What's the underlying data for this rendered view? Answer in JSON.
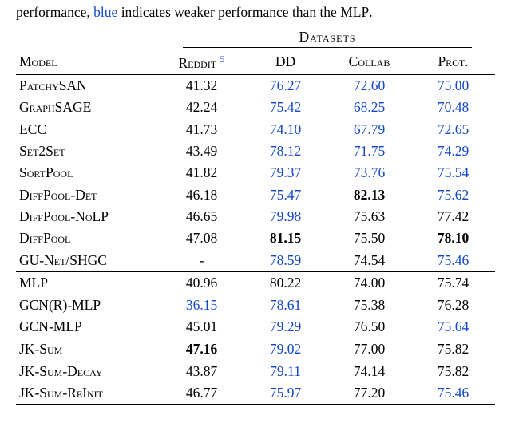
{
  "caption_prefix": "performance, ",
  "caption_blue": "blue",
  "caption_mid": " indicates weaker performance than the ",
  "caption_mlp": "MLP",
  "caption_end": ".",
  "datasets_header": "Datasets",
  "model_header": "Model",
  "columns": [
    {
      "label": "Reddit",
      "sup": "5"
    },
    {
      "label": "DD"
    },
    {
      "label": "Collab"
    },
    {
      "label": "Prot."
    }
  ],
  "groups": [
    {
      "rows": [
        {
          "model": "PatchySAN",
          "vals": [
            {
              "text": "41.32",
              "blue": false,
              "bold": false
            },
            {
              "text": "76.27",
              "blue": true,
              "bold": false
            },
            {
              "text": "72.60",
              "blue": true,
              "bold": false
            },
            {
              "text": "75.00",
              "blue": true,
              "bold": false
            }
          ]
        },
        {
          "model": "GraphSAGE",
          "smallcaps": true,
          "vals": [
            {
              "text": "42.24",
              "blue": false,
              "bold": false
            },
            {
              "text": "75.42",
              "blue": true,
              "bold": false
            },
            {
              "text": "68.25",
              "blue": true,
              "bold": false
            },
            {
              "text": "70.48",
              "blue": true,
              "bold": false
            }
          ]
        },
        {
          "model": "ECC",
          "smallcaps": false,
          "vals": [
            {
              "text": "41.73",
              "blue": false,
              "bold": false
            },
            {
              "text": "74.10",
              "blue": true,
              "bold": false
            },
            {
              "text": "67.79",
              "blue": true,
              "bold": false
            },
            {
              "text": "72.65",
              "blue": true,
              "bold": false
            }
          ]
        },
        {
          "model": "Set2Set",
          "smallcaps": true,
          "vals": [
            {
              "text": "43.49",
              "blue": false,
              "bold": false
            },
            {
              "text": "78.12",
              "blue": true,
              "bold": false
            },
            {
              "text": "71.75",
              "blue": true,
              "bold": false
            },
            {
              "text": "74.29",
              "blue": true,
              "bold": false
            }
          ]
        },
        {
          "model": "SortPool",
          "smallcaps": true,
          "vals": [
            {
              "text": "41.82",
              "blue": false,
              "bold": false
            },
            {
              "text": "79.37",
              "blue": true,
              "bold": false
            },
            {
              "text": "73.76",
              "blue": true,
              "bold": false
            },
            {
              "text": "75.54",
              "blue": true,
              "bold": false
            }
          ]
        },
        {
          "model": "DiffPool-Det",
          "smallcaps": true,
          "vals": [
            {
              "text": "46.18",
              "blue": false,
              "bold": false
            },
            {
              "text": "75.47",
              "blue": true,
              "bold": false
            },
            {
              "text": "82.13",
              "blue": false,
              "bold": true
            },
            {
              "text": "75.62",
              "blue": true,
              "bold": false
            }
          ]
        },
        {
          "model": "DiffPool-NoLP",
          "smallcaps": true,
          "vals": [
            {
              "text": "46.65",
              "blue": false,
              "bold": false
            },
            {
              "text": "79.98",
              "blue": true,
              "bold": false
            },
            {
              "text": "75.63",
              "blue": false,
              "bold": false
            },
            {
              "text": "77.42",
              "blue": false,
              "bold": false
            }
          ]
        },
        {
          "model": "DiffPool",
          "smallcaps": true,
          "vals": [
            {
              "text": "47.08",
              "blue": false,
              "bold": false
            },
            {
              "text": "81.15",
              "blue": false,
              "bold": true
            },
            {
              "text": "75.50",
              "blue": false,
              "bold": false
            },
            {
              "text": "78.10",
              "blue": false,
              "bold": true
            }
          ]
        },
        {
          "model": "GU-Net/SHGC",
          "smallcaps": true,
          "vals": [
            {
              "text": "-",
              "blue": false,
              "bold": false
            },
            {
              "text": "78.59",
              "blue": true,
              "bold": false
            },
            {
              "text": "74.54",
              "blue": false,
              "bold": false
            },
            {
              "text": "75.46",
              "blue": true,
              "bold": false
            }
          ]
        }
      ]
    },
    {
      "rows": [
        {
          "model": "MLP",
          "smallcaps": false,
          "vals": [
            {
              "text": "40.96",
              "blue": false,
              "bold": false
            },
            {
              "text": "80.22",
              "blue": false,
              "bold": false
            },
            {
              "text": "74.00",
              "blue": false,
              "bold": false
            },
            {
              "text": "75.74",
              "blue": false,
              "bold": false
            }
          ]
        },
        {
          "model": "GCN(R)-MLP",
          "smallcaps": false,
          "vals": [
            {
              "text": "36.15",
              "blue": true,
              "bold": false
            },
            {
              "text": "78.61",
              "blue": true,
              "bold": false
            },
            {
              "text": "75.38",
              "blue": false,
              "bold": false
            },
            {
              "text": "76.28",
              "blue": false,
              "bold": false
            }
          ]
        },
        {
          "model": "GCN-MLP",
          "smallcaps": false,
          "vals": [
            {
              "text": "45.01",
              "blue": false,
              "bold": false
            },
            {
              "text": "79.29",
              "blue": true,
              "bold": false
            },
            {
              "text": "76.50",
              "blue": false,
              "bold": false
            },
            {
              "text": "75.64",
              "blue": true,
              "bold": false
            }
          ]
        }
      ]
    },
    {
      "rows": [
        {
          "model": "JK-Sum",
          "smallcaps": true,
          "vals": [
            {
              "text": "47.16",
              "blue": false,
              "bold": true
            },
            {
              "text": "79.02",
              "blue": true,
              "bold": false
            },
            {
              "text": "77.00",
              "blue": false,
              "bold": false
            },
            {
              "text": "75.82",
              "blue": false,
              "bold": false
            }
          ]
        },
        {
          "model": "JK-Sum-Decay",
          "smallcaps": true,
          "vals": [
            {
              "text": "43.87",
              "blue": false,
              "bold": false
            },
            {
              "text": "79.11",
              "blue": true,
              "bold": false
            },
            {
              "text": "74.14",
              "blue": false,
              "bold": false
            },
            {
              "text": "75.82",
              "blue": false,
              "bold": false
            }
          ]
        },
        {
          "model": "JK-Sum-ReInit",
          "smallcaps": true,
          "vals": [
            {
              "text": "46.77",
              "blue": false,
              "bold": false
            },
            {
              "text": "75.97",
              "blue": true,
              "bold": false
            },
            {
              "text": "77.20",
              "blue": false,
              "bold": false
            },
            {
              "text": "75.46",
              "blue": true,
              "bold": false
            }
          ]
        }
      ]
    }
  ],
  "chart_data": {
    "type": "table",
    "title": "Model performance across datasets",
    "columns": [
      "Reddit",
      "DD",
      "Collab",
      "Prot."
    ],
    "rows": [
      {
        "model": "PatchySAN",
        "values": [
          41.32,
          76.27,
          72.6,
          75.0
        ]
      },
      {
        "model": "GraphSAGE",
        "values": [
          42.24,
          75.42,
          68.25,
          70.48
        ]
      },
      {
        "model": "ECC",
        "values": [
          41.73,
          74.1,
          67.79,
          72.65
        ]
      },
      {
        "model": "Set2Set",
        "values": [
          43.49,
          78.12,
          71.75,
          74.29
        ]
      },
      {
        "model": "SortPool",
        "values": [
          41.82,
          79.37,
          73.76,
          75.54
        ]
      },
      {
        "model": "DiffPool-Det",
        "values": [
          46.18,
          75.47,
          82.13,
          75.62
        ]
      },
      {
        "model": "DiffPool-NoLP",
        "values": [
          46.65,
          79.98,
          75.63,
          77.42
        ]
      },
      {
        "model": "DiffPool",
        "values": [
          47.08,
          81.15,
          75.5,
          78.1
        ]
      },
      {
        "model": "GU-Net/SHGC",
        "values": [
          null,
          78.59,
          74.54,
          75.46
        ]
      },
      {
        "model": "MLP",
        "values": [
          40.96,
          80.22,
          74.0,
          75.74
        ]
      },
      {
        "model": "GCN(R)-MLP",
        "values": [
          36.15,
          78.61,
          75.38,
          76.28
        ]
      },
      {
        "model": "GCN-MLP",
        "values": [
          45.01,
          79.29,
          76.5,
          75.64
        ]
      },
      {
        "model": "JK-Sum",
        "values": [
          47.16,
          79.02,
          77.0,
          75.82
        ]
      },
      {
        "model": "JK-Sum-Decay",
        "values": [
          43.87,
          79.11,
          74.14,
          75.82
        ]
      },
      {
        "model": "JK-Sum-ReInit",
        "values": [
          46.77,
          75.97,
          77.2,
          75.46
        ]
      }
    ]
  }
}
